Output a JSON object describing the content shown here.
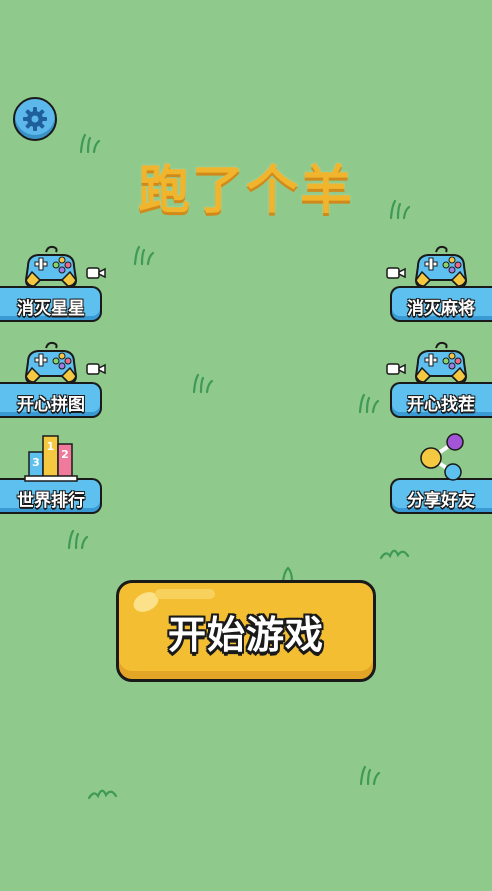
{
  "game": {
    "title": "跑了个羊"
  },
  "left_menu": [
    {
      "label": "消灭星星",
      "icon": "gamepad-icon",
      "has_video": true
    },
    {
      "label": "开心拼图",
      "icon": "gamepad-icon",
      "has_video": true
    },
    {
      "label": "世界排行",
      "icon": "leaderboard-podium-icon",
      "has_video": false,
      "podium": [
        "3",
        "1",
        "2"
      ]
    }
  ],
  "right_menu": [
    {
      "label": "消灭麻将",
      "icon": "gamepad-icon",
      "has_video": true
    },
    {
      "label": "开心找茬",
      "icon": "gamepad-icon",
      "has_video": true
    },
    {
      "label": "分享好友",
      "icon": "share-icon",
      "has_video": false
    }
  ],
  "start_button": {
    "label": "开始游戏"
  },
  "settings": {
    "icon": "gear-icon"
  },
  "colors": {
    "background": "#8fc98b",
    "button_blue": "#5ec0ef",
    "start_yellow": "#f3be32",
    "title_gold": "#f0b52c"
  }
}
